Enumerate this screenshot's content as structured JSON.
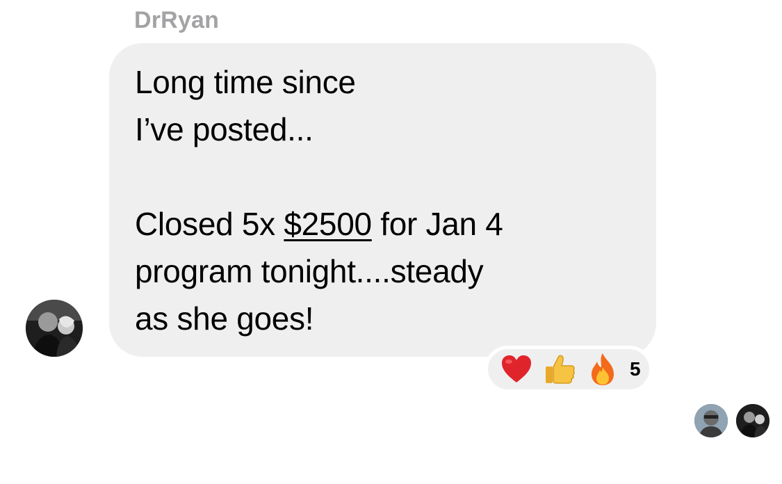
{
  "message": {
    "sender_name": "DrRyan",
    "line1": "Long time since",
    "line2": "I’ve posted...",
    "line3_prefix": "Closed 5x ",
    "line3_amount": "$2500",
    "line3_suffix": " for Jan 4",
    "line4": "program tonight....steady",
    "line5": "as she goes!"
  },
  "reactions": {
    "icons": [
      "heart-icon",
      "thumbs-up-icon",
      "fire-icon"
    ],
    "count": "5"
  },
  "colors": {
    "bubble": "#efeff0",
    "sender_name": "#a3a3a6",
    "heart": "#e0242c",
    "fire": "#f36a1a"
  }
}
